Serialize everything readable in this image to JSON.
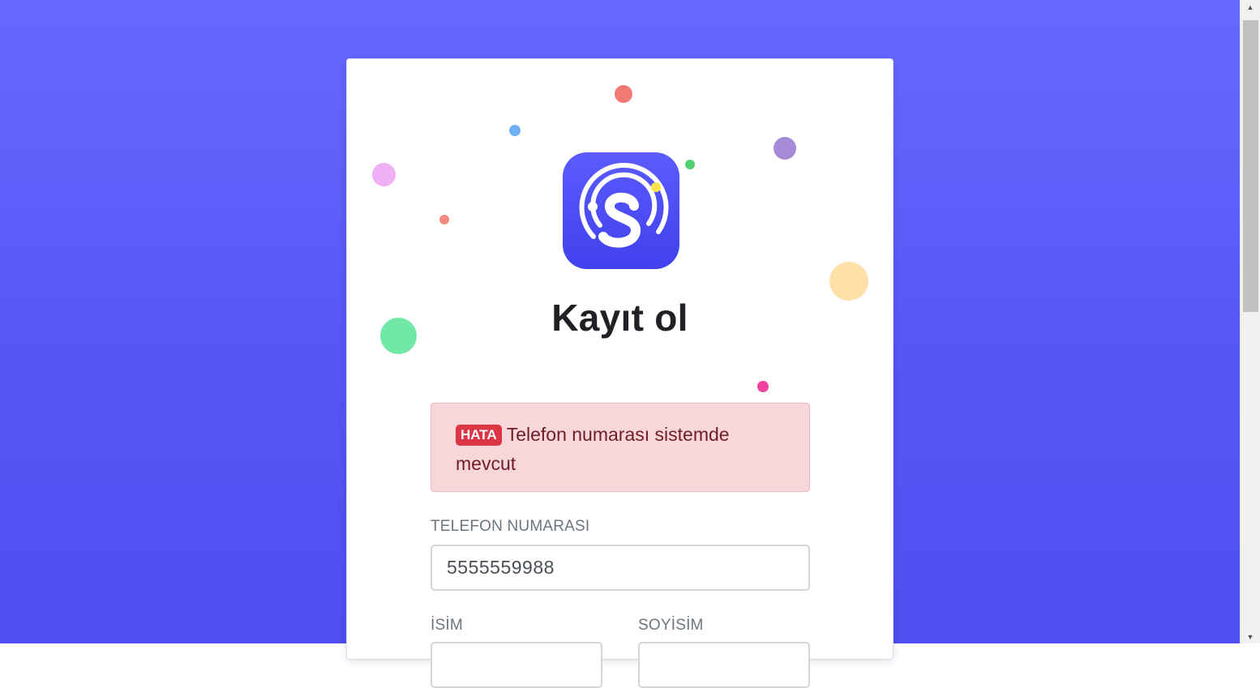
{
  "form": {
    "title": "Kayıt ol",
    "alert": {
      "badge": "HATA",
      "message": "Telefon numarası sistemde mevcut"
    },
    "phone": {
      "label": "TELEFON NUMARASI",
      "value": "5555559988"
    },
    "first_name": {
      "label": "İSİM",
      "value": ""
    },
    "last_name": {
      "label": "SOYİSİM",
      "value": ""
    }
  },
  "logo": {
    "icon": "app-logo-icon",
    "letter": "S"
  },
  "colors": {
    "background": "#5a5af8",
    "card": "#ffffff",
    "alert_bg": "#f8d7da",
    "alert_text": "#721c24",
    "badge": "#dc3545",
    "logo": "#4b4bf5"
  }
}
